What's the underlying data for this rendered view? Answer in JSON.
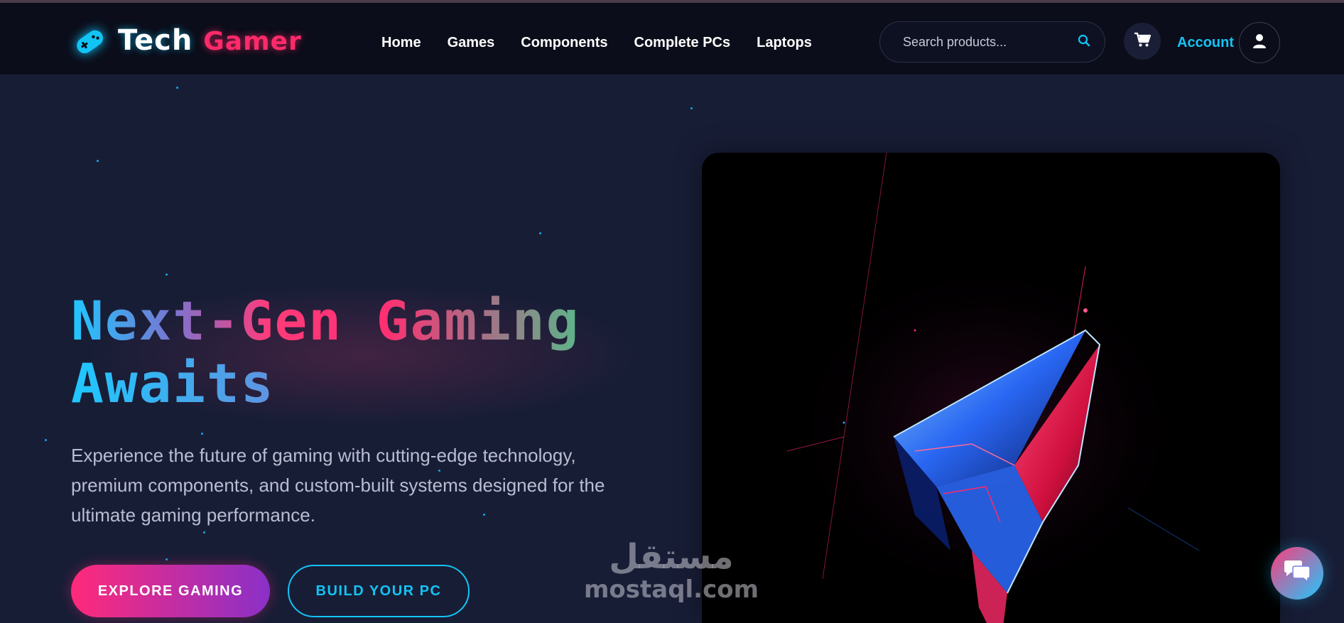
{
  "brand": {
    "part1": "Tech",
    "part2": "Gamer",
    "icon": "gamepad-icon"
  },
  "nav": {
    "items": [
      {
        "label": "Home"
      },
      {
        "label": "Games"
      },
      {
        "label": "Components"
      },
      {
        "label": "Complete PCs"
      },
      {
        "label": "Laptops"
      }
    ]
  },
  "search": {
    "placeholder": "Search products...",
    "icon": "search-icon"
  },
  "cart": {
    "icon": "cart-icon"
  },
  "account": {
    "label": "Account",
    "icon": "user-icon"
  },
  "hero": {
    "title_line1": "Next-Gen Gaming",
    "title_line2": "Awaits",
    "description": "Experience the future of gaming with cutting-edge technology, premium components, and custom-built systems designed for the ultimate gaming performance.",
    "primary_cta": "EXPLORE GAMING",
    "secondary_cta": "BUILD YOUR PC",
    "image": "gaming-crystal-logo-image"
  },
  "watermark": {
    "arabic": "مستقل",
    "latin": "mostaql.com"
  },
  "chat": {
    "icon": "chat-icon"
  },
  "colors": {
    "background": "#181d36",
    "header": "#0b0d1a",
    "accent_cyan": "#12c4f5",
    "accent_pink": "#ff2a6a",
    "accent_green": "#2ee08a"
  }
}
